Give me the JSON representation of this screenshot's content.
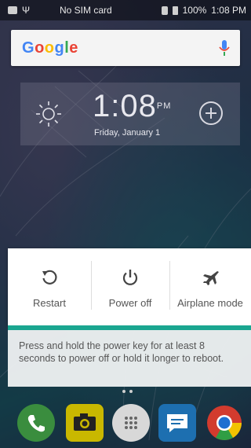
{
  "status_bar": {
    "carrier": "No SIM card",
    "battery": "100%",
    "time": "1:08 PM"
  },
  "search": {
    "logo_letters": [
      "G",
      "o",
      "o",
      "g",
      "l",
      "e"
    ],
    "logo_colors": [
      "#4285f4",
      "#ea4335",
      "#fbbc05",
      "#4285f4",
      "#34a853",
      "#ea4335"
    ]
  },
  "clock_widget": {
    "time": "1:08",
    "ampm": "PM",
    "date": "Friday, January 1"
  },
  "power_menu": {
    "options": [
      {
        "label": "Restart",
        "icon": "restart-icon"
      },
      {
        "label": "Power off",
        "icon": "power-icon"
      },
      {
        "label": "Airplane mode",
        "icon": "airplane-icon"
      }
    ],
    "hint": "Press and hold the power key for at least 8 seconds to power off or hold it longer to reboot.",
    "accent": "#1aa690"
  },
  "dock": {
    "apps": [
      {
        "icon": "phone-icon",
        "color": "#3a8d3e"
      },
      {
        "icon": "camera-icon",
        "color": "#c9b800"
      },
      {
        "icon": "app-drawer-icon",
        "color": "#d8d8d8"
      },
      {
        "icon": "messages-icon",
        "color": "#1d6fb0"
      },
      {
        "icon": "chrome-icon",
        "color": "#d23b2e"
      }
    ]
  }
}
